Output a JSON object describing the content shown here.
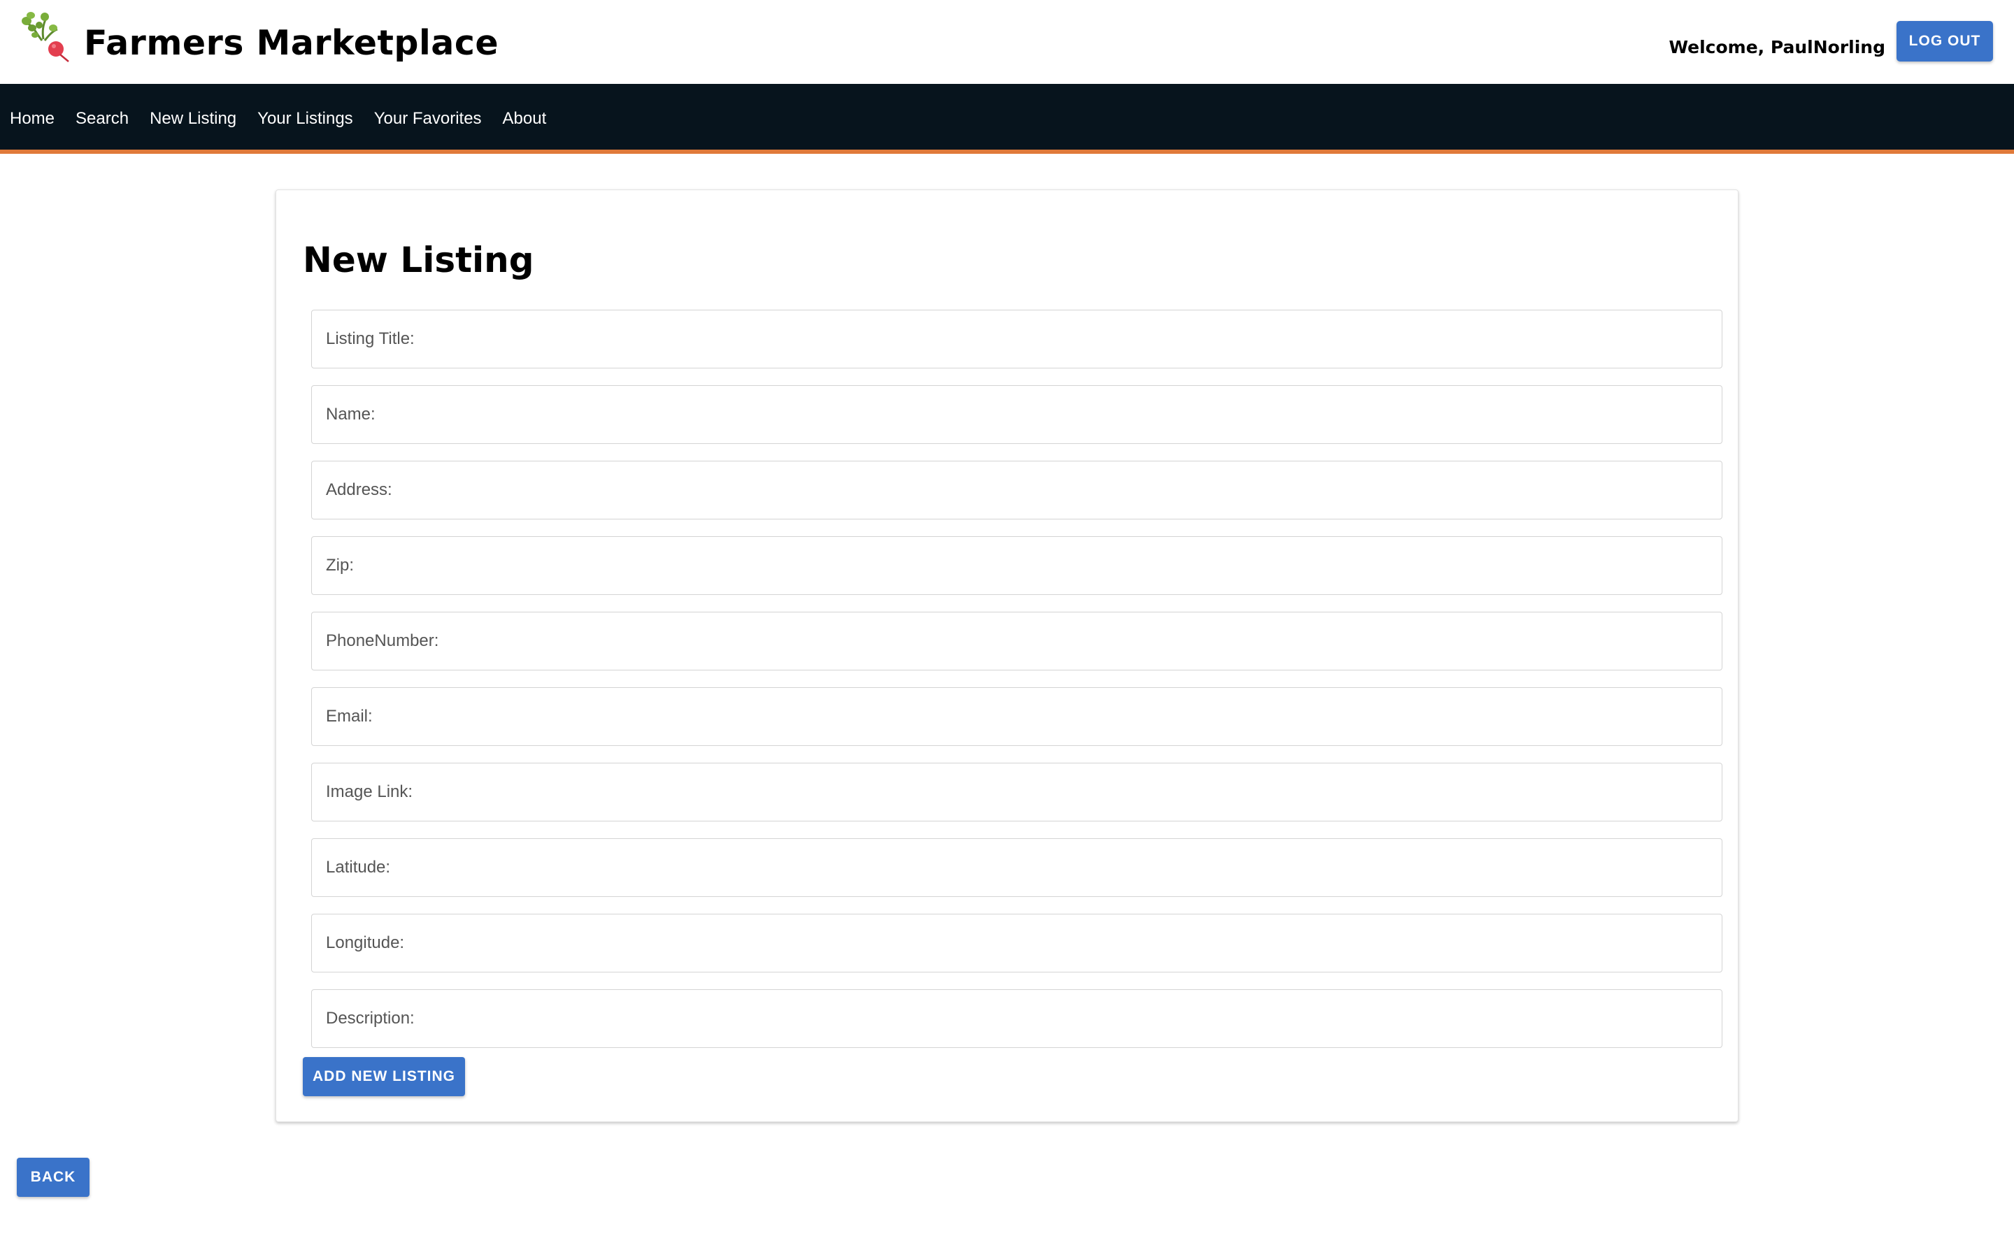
{
  "header": {
    "brand_title": "Farmers Marketplace",
    "welcome_text": "Welcome, PaulNorling",
    "logout_label": "LOG OUT",
    "logo_icon": "radish-icon"
  },
  "nav": {
    "items": [
      {
        "label": "Home"
      },
      {
        "label": "Search"
      },
      {
        "label": "New Listing"
      },
      {
        "label": "Your Listings"
      },
      {
        "label": "Your Favorites"
      },
      {
        "label": "About"
      }
    ]
  },
  "form": {
    "title": "New Listing",
    "fields": [
      {
        "placeholder": "Listing Title:",
        "value": ""
      },
      {
        "placeholder": "Name:",
        "value": ""
      },
      {
        "placeholder": "Address:",
        "value": ""
      },
      {
        "placeholder": "Zip:",
        "value": ""
      },
      {
        "placeholder": "PhoneNumber:",
        "value": ""
      },
      {
        "placeholder": "Email:",
        "value": ""
      },
      {
        "placeholder": "Image Link:",
        "value": ""
      },
      {
        "placeholder": "Latitude:",
        "value": ""
      },
      {
        "placeholder": "Longitude:",
        "value": ""
      },
      {
        "placeholder": "Description:",
        "value": ""
      }
    ],
    "submit_label": "ADD NEW LISTING"
  },
  "back_label": "BACK",
  "colors": {
    "nav_background": "#07141d",
    "nav_accent": "#e07a3a",
    "button": "#3a73c9"
  }
}
